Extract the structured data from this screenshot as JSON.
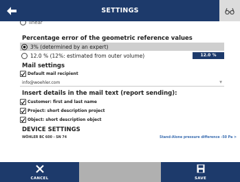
{
  "header": {
    "title": "SETTINGS",
    "back_icon": "back-arrow-icon",
    "corner_icon": "glasses-icon"
  },
  "content": {
    "partial_option": "linear",
    "percentage_section": {
      "title": "Percentage error of the geometric reference values",
      "options": [
        {
          "label": "3% (determined by an expert)",
          "checked": true
        },
        {
          "label": "12.0 % (12%: estimated from outer volume)",
          "checked": false
        }
      ],
      "value_badge": "12.0 %"
    },
    "mail_section": {
      "title": "Mail settings",
      "default_recipient_label": "Default mail recipient",
      "default_recipient_checked": true,
      "email_value": "info@woehler.com"
    },
    "insert_section": {
      "title": "Insert details in the mail text (report sending):",
      "items": [
        {
          "label": "Customer: first and last name",
          "checked": true
        },
        {
          "label": "Project: short description project",
          "checked": true
        },
        {
          "label": "Object: short description object",
          "checked": true
        }
      ]
    },
    "device_section": {
      "title": "DEVICE SETTINGS",
      "device_name": "WÖHLER BC 600 - SN 74",
      "device_info": "Stand-Alone pressure difference -50 Pa >"
    }
  },
  "footer": {
    "cancel_label": "CANCEL",
    "save_label": "SAVE"
  },
  "colors": {
    "primary": "#1d3a6b",
    "accent_text": "#3a6db0",
    "selected_row": "#cfcfcf",
    "footer_gray": "#b0b0b0"
  }
}
